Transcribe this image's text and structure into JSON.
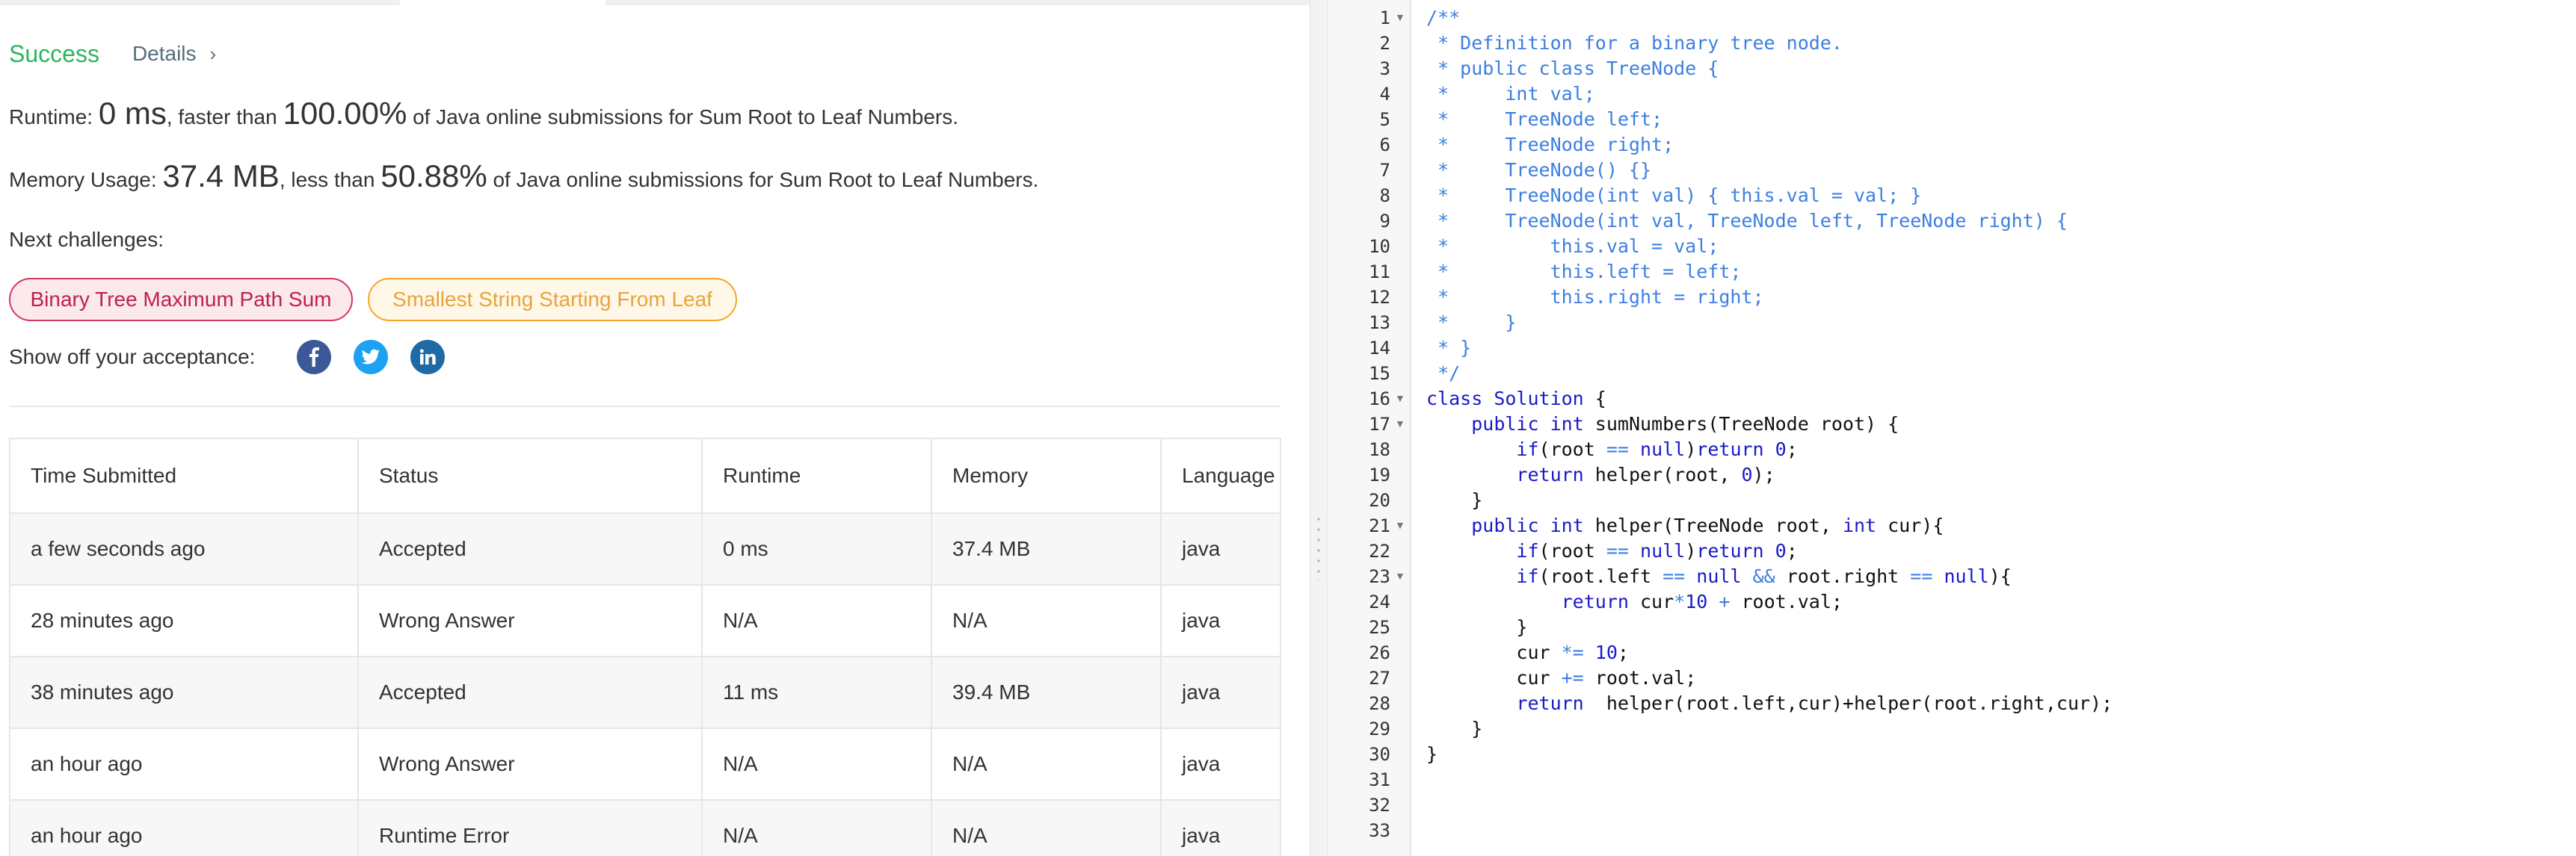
{
  "result": {
    "status": "Success",
    "details_label": "Details",
    "runtime_label": "Runtime:",
    "runtime_value": "0 ms",
    "runtime_compare": ", faster than",
    "runtime_percent": "100.00%",
    "runtime_suffix": "of Java online submissions for Sum Root to Leaf Numbers.",
    "memory_label": "Memory Usage:",
    "memory_value": "37.4 MB",
    "memory_compare": ", less than",
    "memory_percent": "50.88%",
    "memory_suffix": "of Java online submissions for Sum Root to Leaf Numbers."
  },
  "next_challenges": {
    "label": "Next challenges:",
    "items": [
      {
        "title": "Binary Tree Maximum Path Sum",
        "difficulty_color": "#d6375f"
      },
      {
        "title": "Smallest String Starting From Leaf",
        "difficulty_color": "#f5a623"
      }
    ]
  },
  "share": {
    "label": "Show off your acceptance:",
    "icons": [
      "facebook-icon",
      "twitter-icon",
      "linkedin-icon"
    ]
  },
  "submissions": {
    "headers": [
      "Time Submitted",
      "Status",
      "Runtime",
      "Memory",
      "Language"
    ],
    "rows": [
      {
        "time": "a few seconds ago",
        "status": "Accepted",
        "runtime": "0 ms",
        "memory": "37.4 MB",
        "language": "java"
      },
      {
        "time": "28 minutes ago",
        "status": "Wrong Answer",
        "runtime": "N/A",
        "memory": "N/A",
        "language": "java"
      },
      {
        "time": "38 minutes ago",
        "status": "Accepted",
        "runtime": "11 ms",
        "memory": "39.4 MB",
        "language": "java"
      },
      {
        "time": "an hour ago",
        "status": "Wrong Answer",
        "runtime": "N/A",
        "memory": "N/A",
        "language": "java"
      },
      {
        "time": "an hour ago",
        "status": "Runtime Error",
        "runtime": "N/A",
        "memory": "N/A",
        "language": "java"
      }
    ]
  },
  "colors": {
    "success": "#2db55d",
    "accepted": "#3a9c6b",
    "error": "#d0312d",
    "comment": "#3d7fe0",
    "keyword": "#1a1ac8"
  },
  "editor": {
    "line_numbers": [
      "1",
      "2",
      "3",
      "4",
      "5",
      "6",
      "7",
      "8",
      "9",
      "10",
      "11",
      "12",
      "13",
      "14",
      "15",
      "16",
      "17",
      "18",
      "19",
      "20",
      "21",
      "22",
      "23",
      "24",
      "25",
      "26",
      "27",
      "28",
      "29",
      "30",
      "31",
      "32",
      "33"
    ],
    "fold_lines": [
      1,
      16,
      17,
      21,
      23
    ],
    "code": [
      "/**",
      " * Definition for a binary tree node.",
      " * public class TreeNode {",
      " *     int val;",
      " *     TreeNode left;",
      " *     TreeNode right;",
      " *     TreeNode() {}",
      " *     TreeNode(int val) { this.val = val; }",
      " *     TreeNode(int val, TreeNode left, TreeNode right) {",
      " *         this.val = val;",
      " *         this.left = left;",
      " *         this.right = right;",
      " *     }",
      " * }",
      " */",
      "class Solution {",
      "    public int sumNumbers(TreeNode root) {",
      "        if(root == null)return 0;",
      "        return helper(root, 0);",
      "    }",
      "    public int helper(TreeNode root, int cur){",
      "        if(root == null)return 0;",
      "        if(root.left == null && root.right == null){",
      "            return cur*10 + root.val;",
      "        }",
      "        cur *= 10;",
      "        cur += root.val;",
      "        return  helper(root.left,cur)+helper(root.right,cur);",
      "    }",
      "}",
      "",
      "",
      ""
    ]
  }
}
